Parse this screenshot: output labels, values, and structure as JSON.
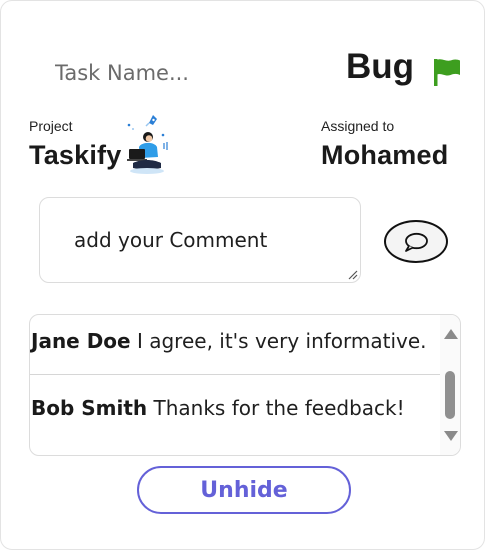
{
  "task": {
    "name_placeholder": "Task Name...",
    "type": "Bug",
    "flag_icon": "flag-icon",
    "flag_color": "#3d9e1f"
  },
  "project": {
    "label": "Project",
    "name": "Taskify",
    "illustration_icon": "person-laptop-rocket-icon"
  },
  "assignee": {
    "label": "Assigned to",
    "name": "Mohamed"
  },
  "comment_input": {
    "placeholder": "add your Comment",
    "send_icon": "speech-bubble-icon"
  },
  "comments": [
    {
      "author": "Jane Doe",
      "text": " I agree, it's very informative."
    },
    {
      "author": "Bob Smith",
      "text": " Thanks for the feedback!"
    }
  ],
  "actions": {
    "unhide_label": "Unhide",
    "accent_color": "#6461d8"
  }
}
